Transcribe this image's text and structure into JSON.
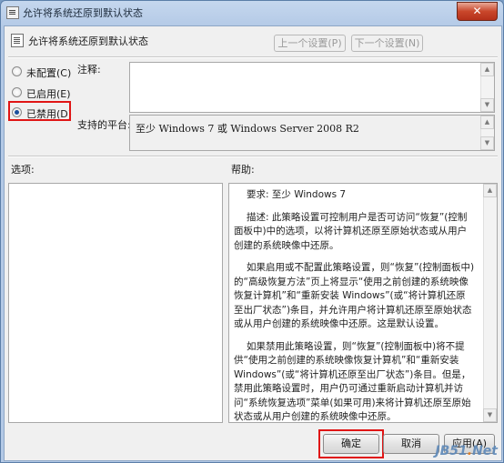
{
  "window": {
    "title": "允许将系统还原到默认状态",
    "close_glyph": "✕"
  },
  "header": {
    "title": "允许将系统还原到默认状态",
    "prev_button": "上一个设置(P)",
    "next_button": "下一个设置(N)"
  },
  "state": {
    "options": [
      {
        "label": "未配置(C)",
        "checked": false
      },
      {
        "label": "已启用(E)",
        "checked": false
      },
      {
        "label": "已禁用(D)",
        "checked": true
      }
    ]
  },
  "labels": {
    "comment": "注释:",
    "supported": "支持的平台:",
    "options": "选项:",
    "help": "帮助:"
  },
  "supported_platforms": "至少 Windows 7 或 Windows Server 2008 R2",
  "help": {
    "paragraphs": [
      "要求: 至少 Windows 7",
      "描述: 此策略设置可控制用户是否可访问“恢复”(控制面板中)中的选项，以将计算机还原至原始状态或从用户创建的系统映像中还原。",
      "如果启用或不配置此策略设置，则“恢复”(控制面板中)的“高级恢复方法”页上将显示“使用之前创建的系统映像恢复计算机”和“重新安装 Windows”(或“将计算机还原至出厂状态”)条目，并允许用户将计算机还原至原始状态或从用户创建的系统映像中还原。这是默认设置。",
      "如果禁用此策略设置，则“恢复”(控制面板中)将不提供“使用之前创建的系统映像恢复计算机”和“重新安装 Windows”(或“将计算机还原至出厂状态”)条目。但是，禁用此策略设置时，用户仍可通过重新启动计算机并访问“系统恢复选项”菜单(如果可用)来将计算机还原至原始状态或从用户创建的系统映像中还原。"
    ]
  },
  "footer": {
    "ok": "确定",
    "cancel": "取消",
    "apply": "应用(A)"
  },
  "watermark": {
    "prefix": "JB51",
    "dot": ".",
    "suffix": "Net"
  }
}
